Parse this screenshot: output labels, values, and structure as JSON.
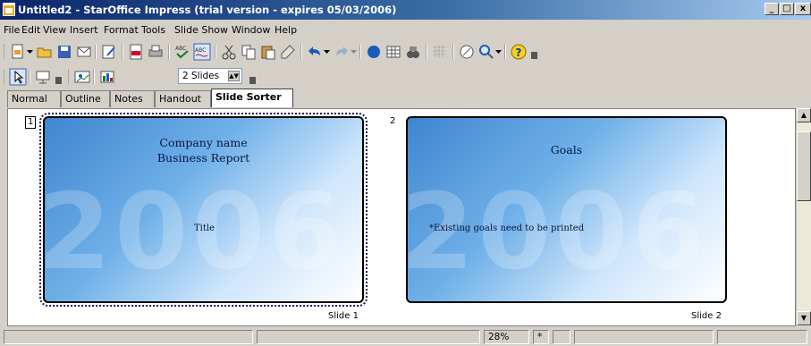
{
  "window": {
    "title": "Untitled2 - StarOffice Impress (trial version - expires 05/03/2006)",
    "buttons": [
      "_",
      "□",
      "x"
    ]
  },
  "menu": [
    "File",
    "Edit",
    "View",
    "Insert",
    "Format",
    "Tools",
    "Slide Show",
    "Window",
    "Help"
  ],
  "toolbar2": {
    "slides_per_row": "2 Slides"
  },
  "tabs": [
    "Normal",
    "Outline",
    "Notes",
    "Handout",
    "Slide Sorter"
  ],
  "slides": [
    {
      "number": "1",
      "title_line1": "Company name",
      "title_line2": "Business Report",
      "big_text": "2006",
      "body": "Title",
      "label": "Slide 1"
    },
    {
      "number": "2",
      "title_line1": "Goals",
      "big_text": "2006",
      "body": "*Existing goals need to be printed",
      "label": "Slide 2"
    }
  ],
  "status": {
    "zoom": "28%",
    "modified": "*"
  },
  "colors": {
    "titlebar": "#0a246a",
    "slide_blue": "#3f86cf",
    "chrome": "#d4d0c8"
  },
  "icons": [
    "app-icon",
    "new-icon",
    "open-icon",
    "save-icon",
    "mail-icon",
    "edit-file-icon",
    "export-pdf-icon",
    "print-icon",
    "spellcheck-icon",
    "autospell-icon",
    "cut-icon",
    "copy-icon",
    "paste-icon",
    "clone-format-icon",
    "undo-icon",
    "redo-icon",
    "chart-icon",
    "table-icon",
    "navigator-icon",
    "grid-icon",
    "gallery-icon",
    "zoom-icon",
    "help-icon",
    "select-icon",
    "slide-show-icon",
    "slide-transition-icon"
  ]
}
